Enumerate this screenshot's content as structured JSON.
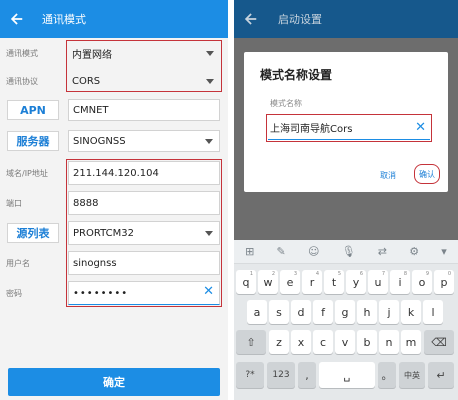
{
  "left": {
    "title": "通讯模式",
    "rows": {
      "mode_label": "通讯模式",
      "mode_value": "内置网络",
      "protocol_label": "通讯协议",
      "protocol_value": "CORS",
      "apn_label": "APN",
      "apn_value": "CMNET",
      "server_label": "服务器",
      "server_value": "SINOGNSS",
      "ip_label": "域名/IP地址",
      "ip_value": "211.144.120.104",
      "port_label": "端口",
      "port_value": "8888",
      "source_label": "源列表",
      "source_value": "PRORTCM32",
      "user_label": "用户名",
      "user_value": "sinognss",
      "pwd_label": "密码",
      "pwd_value": "••••••••"
    },
    "confirm": "确定"
  },
  "right": {
    "title": "启动设置",
    "dialog": {
      "title": "模式名称设置",
      "field_label": "模式名称",
      "field_value": "上海司南导航Cors",
      "cancel": "取消",
      "ok": "确认"
    },
    "keyboard": {
      "row1": [
        "q",
        "w",
        "e",
        "r",
        "t",
        "y",
        "u",
        "i",
        "o",
        "p"
      ],
      "row1_sup": [
        "1",
        "2",
        "3",
        "4",
        "5",
        "6",
        "7",
        "8",
        "9",
        "0"
      ],
      "row2": [
        "a",
        "s",
        "d",
        "f",
        "g",
        "h",
        "j",
        "k",
        "l"
      ],
      "row3": [
        "z",
        "x",
        "c",
        "v",
        "b",
        "n",
        "m"
      ],
      "bottom": {
        "sym": "?*",
        "num": "123",
        "comma": ",",
        "period": "。",
        "lang": "中英"
      }
    }
  }
}
